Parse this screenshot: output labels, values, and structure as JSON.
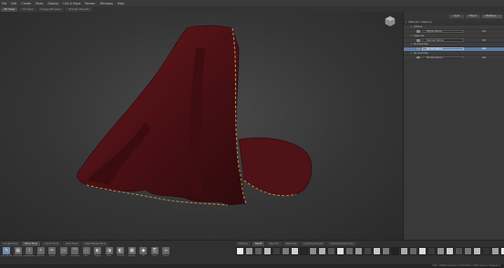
{
  "menubar": {
    "items": [
      "File",
      "Edit",
      "Create",
      "Mesh",
      "Display",
      "UVs & Maps",
      "Render",
      "Windows",
      "Help"
    ]
  },
  "tabs": {
    "items": [
      "3D View",
      "UV View",
      "Image Browser",
      "Shader Presets"
    ],
    "active_index": 0
  },
  "viewport": {
    "object": "dark red cloak model",
    "viewcube_icon": "viewcube-icon"
  },
  "panel": {
    "tabs": [
      "Layer",
      "Object",
      "Shader"
    ],
    "dropdown_value": "Material",
    "rows": [
      {
        "label": "Material 1 (Texture)",
        "type": "header"
      },
      {
        "label": "Diffuse",
        "type": "node"
      },
      {
        "label": "Diffuse texture",
        "type": "child",
        "value": "100"
      },
      {
        "label": "Specular",
        "type": "node"
      },
      {
        "label": "Specular texture",
        "type": "child",
        "value": "100"
      },
      {
        "label": "Normal Map",
        "type": "node"
      },
      {
        "label": "Normal texture",
        "type": "child",
        "value": "100",
        "selected": true
      },
      {
        "label": "Normal Map",
        "type": "node"
      },
      {
        "label": "Normal texture",
        "type": "child",
        "value": "100"
      }
    ]
  },
  "shelf": {
    "tabs": [
      "Sculpt Tools",
      "Paint Tools",
      "Curve Tools",
      "Pose Tools",
      "Select/Mask Tools"
    ],
    "active_tab": 1,
    "tools": [
      {
        "label": "Paint Brush",
        "icon": "brush-icon",
        "glyph": "✎"
      },
      {
        "label": "Projection",
        "icon": "projection-icon",
        "glyph": "▦"
      },
      {
        "label": "Eyedropper",
        "icon": "eyedropper-icon",
        "glyph": "⌇"
      },
      {
        "label": "Airbrush",
        "icon": "airbrush-icon",
        "glyph": "✧"
      },
      {
        "label": "Pencil",
        "icon": "pencil-icon",
        "glyph": "✏"
      },
      {
        "label": "Erase",
        "icon": "eraser-icon",
        "glyph": "▭"
      },
      {
        "label": "Dry Brush",
        "icon": "dry-brush-icon",
        "glyph": "⌒"
      },
      {
        "label": "Blur",
        "icon": "blur-icon",
        "glyph": "◌"
      },
      {
        "label": "Dodge",
        "icon": "dodge-icon",
        "glyph": "◐"
      },
      {
        "label": "Burn",
        "icon": "burn-icon",
        "glyph": "◑"
      },
      {
        "label": "Contrast",
        "icon": "contrast-icon",
        "glyph": "◧"
      },
      {
        "label": "Sponge",
        "icon": "sponge-icon",
        "glyph": "▩"
      },
      {
        "label": "Fill",
        "icon": "fill-icon",
        "glyph": "◆"
      },
      {
        "label": "Clone",
        "icon": "clone-icon",
        "glyph": "⎘"
      },
      {
        "label": "Smear",
        "icon": "smear-icon",
        "glyph": "≈"
      }
    ],
    "stamp_tabs": [
      "Stamps",
      "Falloff",
      "Stencils",
      "Materials",
      "Lighting Presets",
      "Camera Bookmarks"
    ],
    "stamp_active": 1,
    "stamps": [
      "#eeeeee",
      "#9a9a9a",
      "#5e5e5e",
      "#bdbdbd",
      "#3f3f3f",
      "#7c7c7c",
      "#cfcfcf",
      "#272727",
      "#8c8c8c",
      "#b3b3b3",
      "#555555",
      "#e3e3e3",
      "#6a6a6a",
      "#999999",
      "#444444",
      "#c8c8c8",
      "#7a7a7a",
      "#222222",
      "#aaaaaa",
      "#666666",
      "#dddddd",
      "#3a3a3a",
      "#909090",
      "#cccccc",
      "#505050",
      "#777777",
      "#bbbbbb",
      "#333333",
      "#a0a0a0",
      "#e8e8e8"
    ]
  },
  "status": {
    "text": "Total: 200000 Selected: 0 GPU Mem: 2550 Active: 0 Highest: 0"
  },
  "colors": {
    "cloak": "#5a1418",
    "trim": "#b08a4a",
    "selection": "#5b7ea3"
  }
}
